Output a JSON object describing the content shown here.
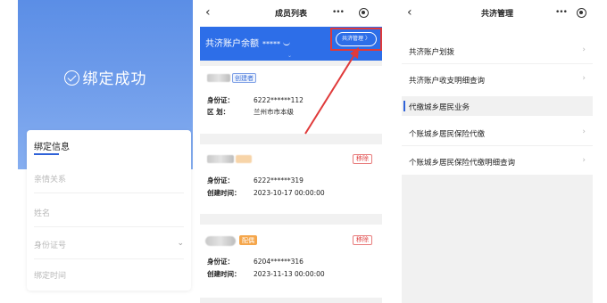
{
  "panel1": {
    "success_text": "绑定成功",
    "card_title": "绑定信息",
    "fields": [
      "亲情关系",
      "姓名",
      "身份证号",
      "绑定时间"
    ],
    "dropdown_arrow": "⌄"
  },
  "panel2": {
    "nav": {
      "back": "‹",
      "title": "成员列表",
      "more": "•••"
    },
    "banner": {
      "label": "共济账户余额",
      "value": "*****",
      "button": "共济管理 〉"
    },
    "cards": [
      {
        "tag": "创建者",
        "id_label": "身份证：",
        "id_value": "6222******112",
        "area_label": "区  划：",
        "area_value": "兰州市市本级"
      },
      {
        "remove": "移除",
        "id_label": "身份证：",
        "id_value": "6222******319",
        "time_label": "创建时间：",
        "time_value": "2023-10-17 00:00:00"
      },
      {
        "tag": "配偶",
        "remove": "移除",
        "id_label": "身份证：",
        "id_value": "6204******316",
        "time_label": "创建时间：",
        "time_value": "2023-11-13 00:00:00"
      }
    ]
  },
  "panel3": {
    "nav": {
      "back": "‹",
      "title": "共济管理",
      "more": "•••"
    },
    "items": [
      {
        "label": "共济账户划拨",
        "chev": "›"
      },
      {
        "label": "共济账户收支明细查询",
        "chev": "›"
      }
    ],
    "section": "代缴城乡居民业务",
    "items2": [
      {
        "label": "个账城乡居民保险代缴",
        "chev": "›"
      },
      {
        "label": "个账城乡居民保险代缴明细查询",
        "chev": "›"
      }
    ]
  },
  "colors": {
    "primary_blue": "#2d6ee8",
    "hero_blue": "#6d9bea",
    "remove_red": "#e04545",
    "tag_orange": "#f5a64b"
  },
  "icons": [
    "check-circle-icon",
    "back-arrow-icon",
    "more-dots-icon",
    "target-icon",
    "chevron-right-icon",
    "eye-closed-icon",
    "dropdown-icon"
  ]
}
